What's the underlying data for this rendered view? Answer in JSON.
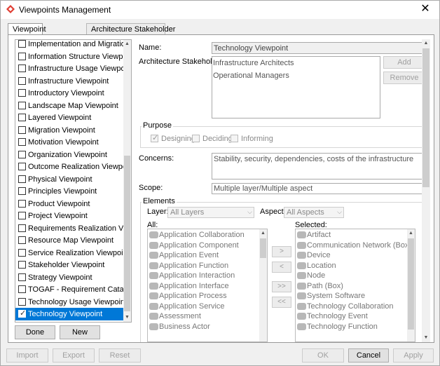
{
  "window": {
    "title": "Viewpoints Management",
    "close": "✕"
  },
  "tabs": [
    "Viewpoint",
    "Architecture Stakeholder"
  ],
  "viewpoints": [
    {
      "label": "Implementation and Migration ...",
      "checked": false
    },
    {
      "label": "Information Structure Viewpoint",
      "checked": false
    },
    {
      "label": "Infrastructure Usage Viewpoint",
      "checked": false
    },
    {
      "label": "Infrastructure Viewpoint",
      "checked": false
    },
    {
      "label": "Introductory Viewpoint",
      "checked": false
    },
    {
      "label": "Landscape Map Viewpoint",
      "checked": false
    },
    {
      "label": "Layered Viewpoint",
      "checked": false
    },
    {
      "label": "Migration Viewpoint",
      "checked": false
    },
    {
      "label": "Motivation Viewpoint",
      "checked": false
    },
    {
      "label": "Organization Viewpoint",
      "checked": false
    },
    {
      "label": "Outcome Realization Viewpoint",
      "checked": false
    },
    {
      "label": "Physical Viewpoint",
      "checked": false
    },
    {
      "label": "Principles Viewpoint",
      "checked": false
    },
    {
      "label": "Product Viewpoint",
      "checked": false
    },
    {
      "label": "Project Viewpoint",
      "checked": false
    },
    {
      "label": "Requirements Realization View...",
      "checked": false
    },
    {
      "label": "Resource Map Viewpoint",
      "checked": false
    },
    {
      "label": "Service Realization Viewpoint",
      "checked": false
    },
    {
      "label": "Stakeholder Viewpoint",
      "checked": false
    },
    {
      "label": "Strategy Viewpoint",
      "checked": false
    },
    {
      "label": "TOGAF - Requirement Catalog",
      "checked": false
    },
    {
      "label": "Technology Usage Viewpoint",
      "checked": false
    },
    {
      "label": "Technology Viewpoint",
      "checked": true,
      "selected": true
    }
  ],
  "list_buttons": {
    "done": "Done",
    "new": "New"
  },
  "form": {
    "name_label": "Name:",
    "name_value": "Technology Viewpoint",
    "stakeholders_label": "Architecture Stakeholders:",
    "stakeholders": [
      "Infrastructure Architects",
      "Operational Managers"
    ],
    "add": "Add",
    "remove": "Remove",
    "purpose_title": "Purpose",
    "purposes": [
      {
        "label": "Designing",
        "checked": true
      },
      {
        "label": "Deciding",
        "checked": false
      },
      {
        "label": "Informing",
        "checked": false
      }
    ],
    "concerns_label": "Concerns:",
    "concerns_value": "Stability, security, dependencies, costs of the infrastructure",
    "scope_label": "Scope:",
    "scope_value": "Multiple layer/Multiple aspect",
    "elements_title": "Elements",
    "layer_label": "Layer:",
    "layer_value": "All Layers",
    "aspect_label": "Aspect:",
    "aspect_value": "All Aspects",
    "all_label": "All:",
    "selected_label": "Selected:",
    "all_items": [
      "Application Collaboration",
      "Application Component",
      "Application Event",
      "Application Function",
      "Application Interaction",
      "Application Interface",
      "Application Process",
      "Application Service",
      "Assessment",
      "Business Actor"
    ],
    "selected_items": [
      "Artifact",
      "Communication Network (Box)",
      "Device",
      "Location",
      "Node",
      "Path (Box)",
      "System Software",
      "Technology Collaboration",
      "Technology Event",
      "Technology Function"
    ],
    "move": {
      "add_one": ">",
      "remove_one": "<",
      "add_all": ">>",
      "remove_all": "<<"
    }
  },
  "bottom": {
    "import": "Import",
    "export": "Export",
    "reset": "Reset",
    "ok": "OK",
    "cancel": "Cancel",
    "apply": "Apply"
  },
  "colors": {
    "selection": "#0078d7",
    "brand": "#e03c31"
  }
}
